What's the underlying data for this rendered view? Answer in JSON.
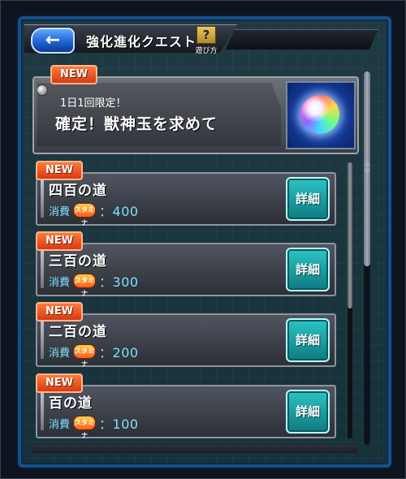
{
  "header": {
    "title": "強化進化クエスト",
    "back_icon": "←",
    "help_icon": "?",
    "help_label": "遊び方"
  },
  "featured": {
    "badge": "NEW",
    "subtitle": "1日1回限定！",
    "title": "確定！獣神玉を求めて",
    "image": "orb-icon"
  },
  "quests": [
    {
      "badge": "NEW",
      "title": "四百の道",
      "cost_label": "消費",
      "stamina_icon": "スタミナ",
      "cost_value": "：400",
      "detail_label": "詳細"
    },
    {
      "badge": "NEW",
      "title": "三百の道",
      "cost_label": "消費",
      "stamina_icon": "スタミナ",
      "cost_value": "：300",
      "detail_label": "詳細"
    },
    {
      "badge": "NEW",
      "title": "二百の道",
      "cost_label": "消費",
      "stamina_icon": "スタミナ",
      "cost_value": "：200",
      "detail_label": "詳細"
    },
    {
      "badge": "NEW",
      "title": "百の道",
      "cost_label": "消費",
      "stamina_icon": "スタミナ",
      "cost_value": "：100",
      "detail_label": "詳細"
    }
  ],
  "colors": {
    "badge": "#e0481a",
    "detail_button": "#1aa3a8",
    "cost_text": "#7fe0ff",
    "panel_border": "#16508a"
  }
}
